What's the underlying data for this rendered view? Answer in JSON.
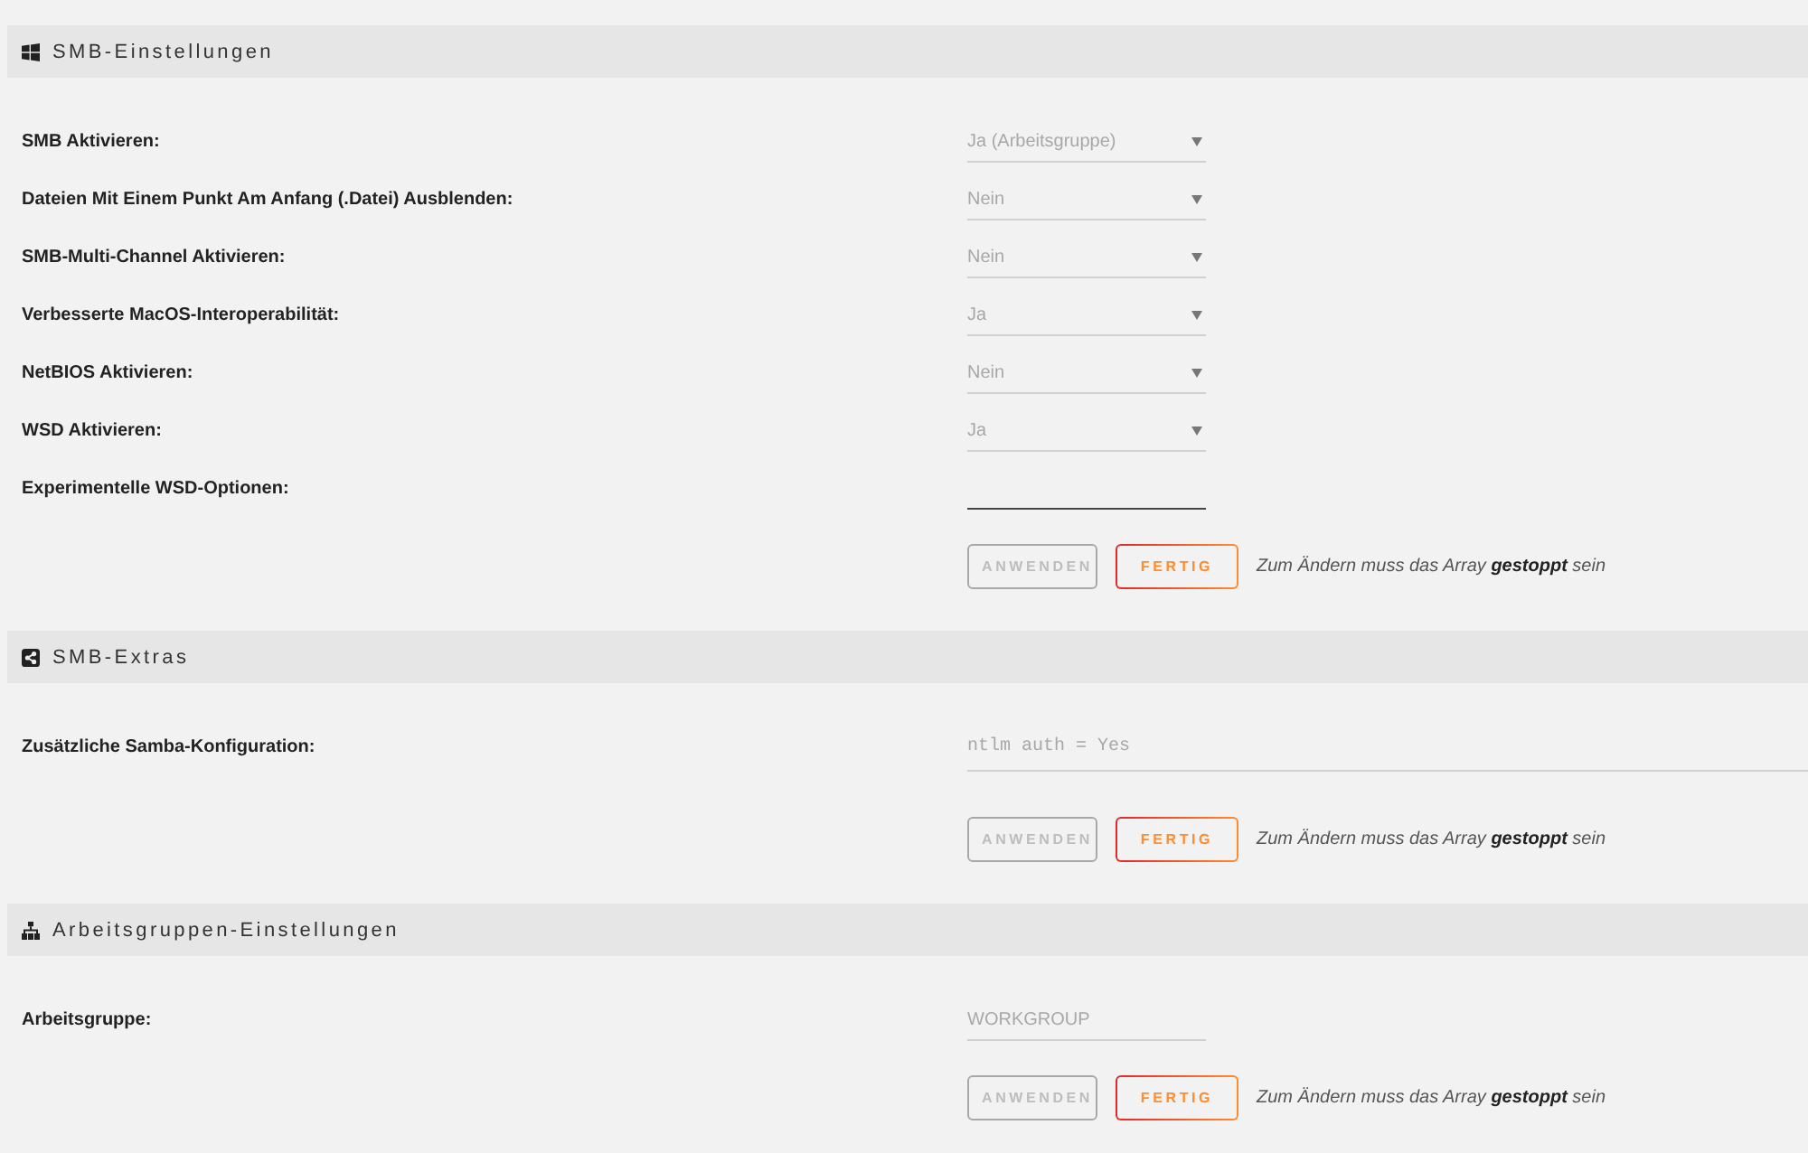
{
  "sections": [
    {
      "title": "SMB-Einstellungen",
      "rows": [
        {
          "label": "SMB Aktivieren:",
          "kind": "select",
          "value": "Ja (Arbeitsgruppe)",
          "disabled": true
        },
        {
          "label": "Dateien Mit Einem Punkt Am Anfang (.Datei) Ausblenden:",
          "kind": "select",
          "value": "Nein",
          "disabled": true
        },
        {
          "label": "SMB-Multi-Channel Aktivieren:",
          "kind": "select",
          "value": "Nein",
          "disabled": true
        },
        {
          "label": "Verbesserte MacOS-Interoperabilität:",
          "kind": "select",
          "value": "Ja",
          "disabled": true
        },
        {
          "label": "NetBIOS Aktivieren:",
          "kind": "select",
          "value": "Nein",
          "disabled": true
        },
        {
          "label": "WSD Aktivieren:",
          "kind": "select",
          "value": "Ja",
          "disabled": true
        },
        {
          "label": "Experimentelle WSD-Optionen:",
          "kind": "input",
          "disabled": false
        }
      ],
      "buttons": [
        {
          "label": "ANWENDEN",
          "disabled": true
        },
        {
          "label": "FERTIG",
          "disabled": false
        }
      ],
      "note": "Zum Ändern muss das Array **gestoppt** sein"
    },
    {
      "title": "SMB-Extras",
      "rows": [
        {
          "label": "Zusätzliche Samba-Konfiguration:",
          "kind": "textarea",
          "value": "ntlm auth = Yes",
          "disabled": true
        }
      ],
      "buttons": [
        {
          "label": "ANWENDEN",
          "disabled": true
        },
        {
          "label": "FERTIG",
          "disabled": false
        }
      ],
      "note": "Zum Ändern muss das Array **gestoppt** sein"
    },
    {
      "title": "Arbeitsgruppen-Einstellungen",
      "rows": [
        {
          "label": "Arbeitsgruppe:",
          "kind": "input",
          "value": "WORKGROUP",
          "disabled": true
        }
      ],
      "buttons": [
        {
          "label": "ANWENDEN",
          "disabled": true
        },
        {
          "label": "FERTIG",
          "disabled": false
        }
      ],
      "note": "Zum Ändern muss das Array **gestoppt** sein"
    }
  ]
}
